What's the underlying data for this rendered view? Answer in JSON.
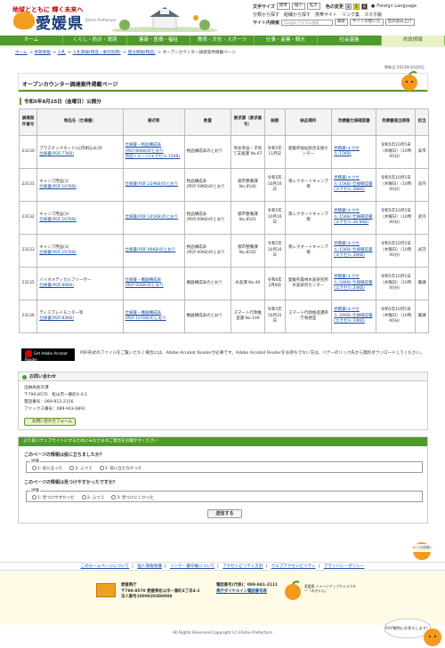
{
  "header": {
    "logo_tagline": "地域とともに 輝く未来へ",
    "logo_title": "愛媛県",
    "logo_sub": "Ehime Prefecture",
    "tools": {
      "text_size_label": "文字サイズ",
      "size_std": "標準",
      "size_small": "縮小",
      "size_large": "拡大",
      "color_label": "色の変更",
      "color_opts": [
        "青",
        "黄",
        "黒"
      ],
      "foreign": "Foreign Language",
      "row2": [
        "分類から探す",
        "組織から探す",
        "携帯サイト",
        "リンク集",
        "スマホ版"
      ],
      "search_label": "サイト内検索",
      "search_placeholder": "Google カスタム検索",
      "search_btn": "検索",
      "sitemap": "サイトの使い方",
      "voice": "音声読み上げ"
    }
  },
  "nav": [
    "ホーム",
    "くらし・防災・環境",
    "健康・医療・福祉",
    "教育・文化・スポーツ",
    "仕事・産業・観光",
    "社会基盤",
    "県政情報"
  ],
  "breadcrumb": [
    "ホーム",
    "県政情報",
    "入札",
    "入札情報(物品・委託役務)",
    "発注情報(物品)",
    "オープンカウンター調達案件掲載ページ"
  ],
  "updated": "更新日:2023年10月4日",
  "page_title": "オープンカウンター調達案件掲載ページ",
  "section_title": "令和5年9月25日（金曜日）公開分",
  "table": {
    "headers": [
      "調達案件番号",
      "物品名（仕様書）",
      "様式等",
      "数量",
      "要求課（要求番号）",
      "納期",
      "納品場所",
      "見積書仕様確認書",
      "見積書提出期限",
      "担当"
    ],
    "rows": [
      {
        "no": "23130",
        "name": "プラスチックカード(公印刷込み)外",
        "spec": "仕様書(PDF:77KB)",
        "forms": [
          "仕様書・物品構成表(PDF:80KB)のとおり",
          "完成イメージ(エクセル:15KB)"
        ],
        "qty": "物品構成表のとおり",
        "dept": "男女参画・子育て支援課 No.67",
        "due": "令和5年11月日",
        "place": "愛媛県福祉総合支援センター",
        "quote": "見積書(エクセル:15KB)",
        "deadline": "令和5年10月5日（木曜日）（10時00分）",
        "staff": "高市"
      },
      {
        "no": "23131",
        "name": "キャンプ用品(1)",
        "spec": "仕様書(PDF:107KB)",
        "forms": [
          "仕様書(PDF:229KB)のとおり"
        ],
        "qty": "物品構成表(PDF:59KB)のとおり",
        "dept": "都市整備課 No.8540",
        "due": "令和5年10月16日",
        "place": "南レクオートキャンプ場",
        "quote": "見積書(エクセル:15KB) 仕様確認書(エクセル:36KB)",
        "deadline": "令和5年10月5日（木曜日）（10時00分）",
        "staff": "武内"
      },
      {
        "no": "23132",
        "name": "キャンプ用品(2)",
        "spec": "仕様書(PDF:107KB)",
        "forms": [
          "仕様書(PDF:105KB)のとおり"
        ],
        "qty": "物品構成表(PDF:69KB)のとおり",
        "dept": "都市整備課 No.8541",
        "due": "令和5年10月16日",
        "place": "南レクオートキャンプ場",
        "quote": "見積書(エクセル:15KB) 仕様確認書(エクセル:36.6KB)",
        "deadline": "令和5年10月5日（木曜日）（10時00分）",
        "staff": "武内"
      },
      {
        "no": "23133",
        "name": "キャンプ用品(3)",
        "spec": "仕様書(PDF:107KB)",
        "forms": [
          "仕様書(PDF:96KB)のとおり"
        ],
        "qty": "物品構成表(PDF:60KB)のとおり",
        "dept": "都市整備課 No.8542",
        "due": "令和5年10月16日",
        "place": "南レクオートキャンプ場",
        "quote": "見積書(エクセル:15KB) 仕様確認書(エクセル:36KB)",
        "deadline": "令和5年10月5日（木曜日）（10時00分）",
        "staff": "武内"
      },
      {
        "no": "23135",
        "name": "バイオメディカルフリーザー",
        "spec": "仕様書(PDF:80KB)",
        "forms": [
          "仕様書・機器構成表(PDF:92KB)のとおり"
        ],
        "qty": "機器構成表のとおり",
        "dept": "水産課 No.46",
        "due": "令和6年2月8日",
        "place": "愛媛県農林水産研究所水産研究センター",
        "quote": "見積書(エクセル:34KB) 仕様確認書(エクセル:34KB)",
        "deadline": "令和5年10月5日（木曜日）（10時00分）",
        "staff": "廣瀬"
      },
      {
        "no": "23136",
        "name": "ディスプレイモニター等",
        "spec": "仕様書(PDF:83KB)",
        "forms": [
          "仕様書・機器構成表(PDF:107KB)のとおり"
        ],
        "qty": "機器構成表のとおり",
        "dept": "スマート行政推進課 No.109",
        "due": "令和5年10月31日",
        "place": "スマート行政推進課県庁執務室",
        "quote": "見積書(エクセル:34KB) 仕様確認書(エクセル:34KB)",
        "deadline": "令和5年10月5日（木曜日）（10時00分）",
        "staff": "廣瀬"
      }
    ]
  },
  "acrobat": {
    "badge": "Get Adobe Acrobat Reader",
    "text": "PDF形式のファイルをご覧いただく場合には、Adobe Acrobat Readerが必要です。Adobe Acrobat Readerをお持ちでない方は、バナーのリンク先から無料ダウンロードしてください。"
  },
  "contact": {
    "heading": "お問い合わせ",
    "lines": [
      "出納局会計課",
      "〒790-8570　松山市一番町4-4-2",
      "電話番号：089-912-2156",
      "ファックス番号：089-943-6891"
    ],
    "form_btn": "お問い合わせフォーム"
  },
  "survey": {
    "heading": "より良いウェブサイトにするためにみなさまのご意見をお聞かせください",
    "q1": "このページの情報は役に立ちましたか？",
    "legend": "評価",
    "q1_opts": [
      "1: 役に立った",
      "2: ふつう",
      "3: 役に立たなかった"
    ],
    "q2": "このページの情報は見つけやすかったですか？",
    "legend2": "評価",
    "q2_opts": [
      "1: 見つけやすかった",
      "2: ふつう",
      "3: 見つけにくかった"
    ],
    "send": "送信する"
  },
  "pagetop": "ページの先頭へ",
  "footer_links": [
    "このホームページについて",
    "個人情報保護",
    "リンク・著作権について",
    "アクセシビリティ方針",
    "ウェブアクセシビリティ",
    "プライバシーポリシー"
  ],
  "footer": {
    "org": "愛媛県庁",
    "addr": "〒790-8570 愛媛県松山市一番町4丁目4-2",
    "corp": "法人番号1000020380008",
    "phone": "電話番号(代表)：089-941-2111",
    "dial": "県庁ダイヤルイン電話番号表",
    "char_name": "愛媛県 イメージアップキャラクター「みきゃん」"
  },
  "copyright": "All Rights Reserved Copyright (c) Ehime Prefecture",
  "ai": "AIが質問にお答えします！"
}
